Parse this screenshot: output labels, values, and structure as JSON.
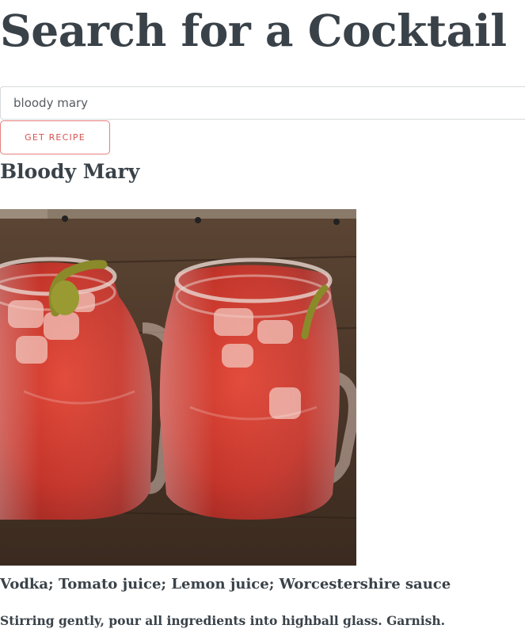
{
  "header": {
    "title": "Search for a Cocktail"
  },
  "search": {
    "value": "bloody mary",
    "button_label": "GET RECIPE"
  },
  "result": {
    "name": "Bloody Mary",
    "ingredients": "Vodka; Tomato juice; Lemon juice; Worcestershire sauce",
    "instructions": "Stirring gently, pour all ingredients into highball glass. Garnish."
  },
  "colors": {
    "text": "#3a4249",
    "button_border": "#e57e7e",
    "button_text": "#d9534f",
    "input_border": "#d7d9db"
  }
}
